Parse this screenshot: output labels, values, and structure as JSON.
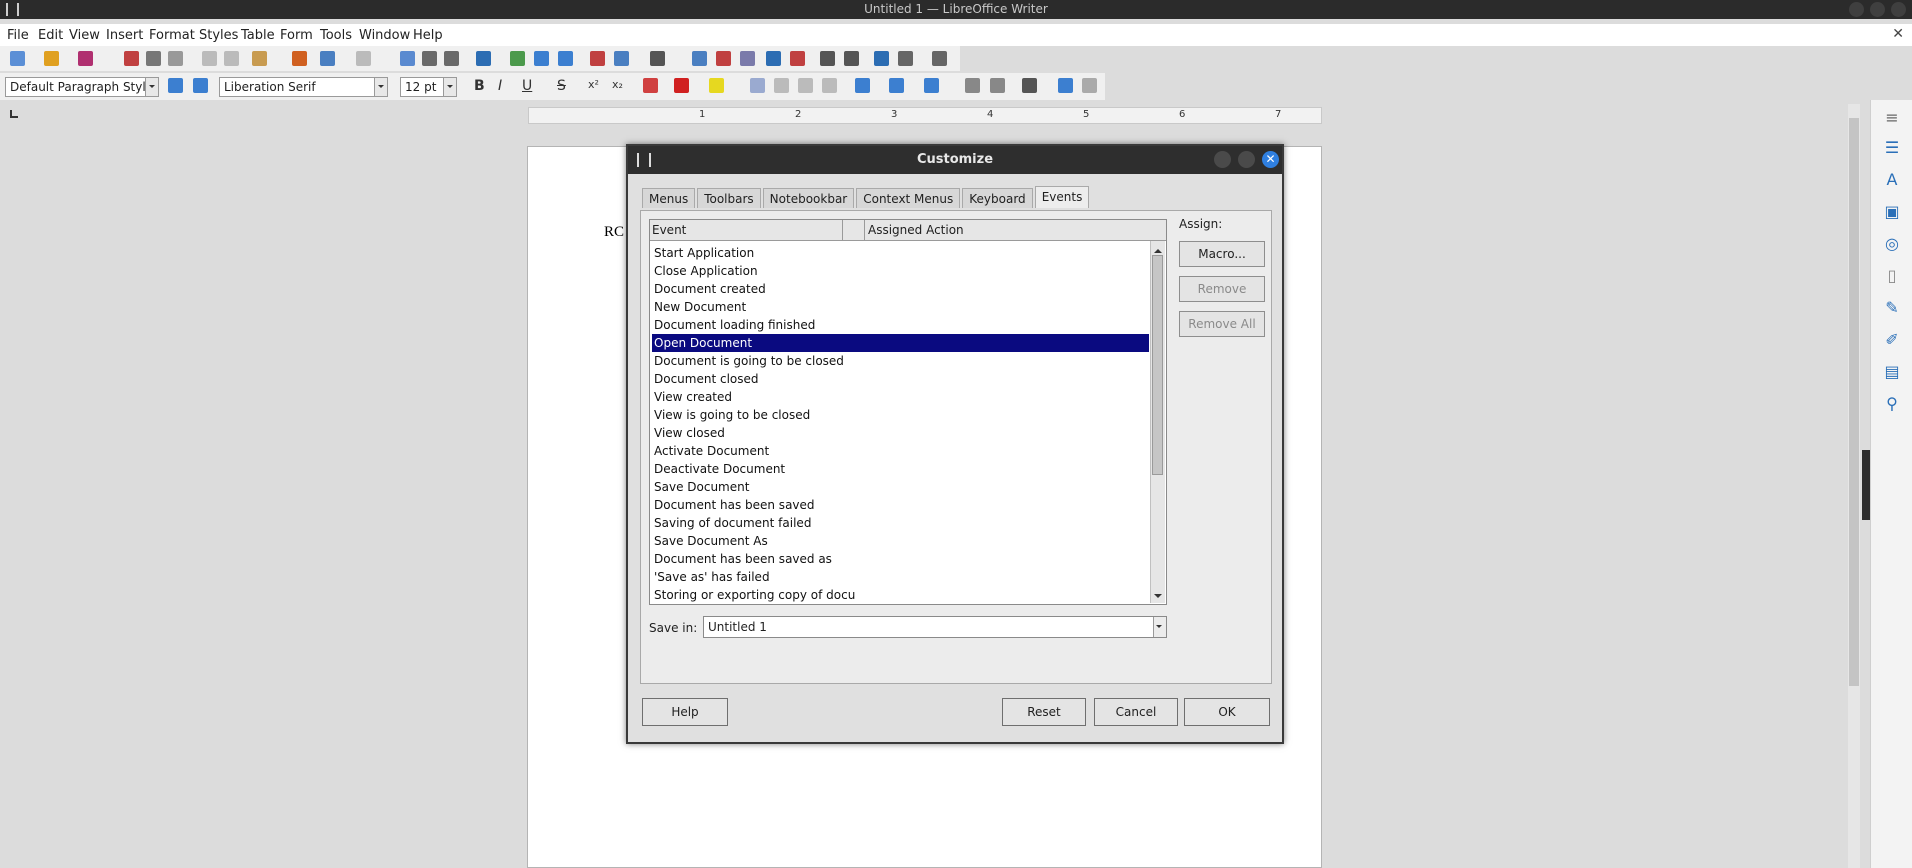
{
  "window": {
    "title": "Untitled 1 — LibreOffice Writer"
  },
  "menubar": {
    "items": [
      "File",
      "Edit",
      "View",
      "Insert",
      "Format",
      "Styles",
      "Table",
      "Form",
      "Tools",
      "Window",
      "Help"
    ]
  },
  "formatting": {
    "paragraph_style": "Default Paragraph Style",
    "font_name": "Liberation Serif",
    "font_size": "12 pt",
    "bold": "B",
    "italic": "I",
    "underline": "U",
    "strike": "S",
    "superscript": "x²",
    "subscript": "x₂"
  },
  "ruler": {
    "marks": [
      "1",
      "2",
      "3",
      "4",
      "5",
      "6",
      "7"
    ]
  },
  "document": {
    "text": "RC"
  },
  "dialog": {
    "title": "Customize",
    "tabs": [
      "Menus",
      "Toolbars",
      "Notebookbar",
      "Context Menus",
      "Keyboard",
      "Events"
    ],
    "active_tab": "Events",
    "columns": {
      "event": "Event",
      "action": "Assigned Action"
    },
    "events": [
      "Start Application",
      "Close Application",
      "Document created",
      "New Document",
      "Document loading finished",
      "Open Document",
      "Document is going to be closed",
      "Document closed",
      "View created",
      "View is going to be closed",
      "View closed",
      "Activate Document",
      "Deactivate Document",
      "Save Document",
      "Document has been saved",
      "Saving of document failed",
      "Save Document As",
      "Document has been saved as",
      "'Save as' has failed",
      "Storing or exporting copy of docu"
    ],
    "selected_event": "Open Document",
    "assign": {
      "label": "Assign:",
      "macro": "Macro...",
      "remove": "Remove",
      "remove_all": "Remove All"
    },
    "save_in": {
      "label": "Save in:",
      "value": "Untitled 1"
    },
    "buttons": {
      "help": "Help",
      "reset": "Reset",
      "cancel": "Cancel",
      "ok": "OK"
    }
  },
  "colors": {
    "selection": "#0a0a80",
    "titlebar": "#2e2e2e",
    "close": "#2f7fe0"
  }
}
